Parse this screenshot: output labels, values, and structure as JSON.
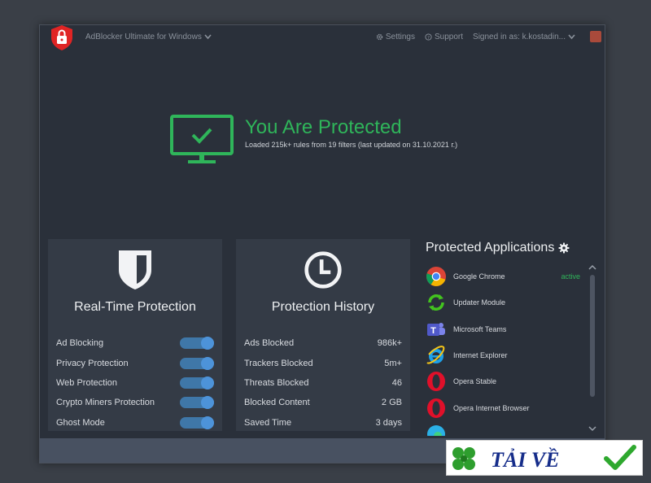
{
  "window": {
    "app_title": "AdBlocker Ultimate for Windows",
    "settings_label": "Settings",
    "support_label": "Support",
    "signed_in_label": "Signed in as: k.kostadin...",
    "close_color": "#a94a3b"
  },
  "status": {
    "title": "You Are Protected",
    "subtitle": "Loaded 215k+ rules from 19 filters (last updated on 31.10.2021 г.)",
    "color": "#2fb55a"
  },
  "realtime": {
    "title": "Real-Time Protection",
    "items": [
      {
        "label": "Ad Blocking",
        "enabled": true
      },
      {
        "label": "Privacy Protection",
        "enabled": true
      },
      {
        "label": "Web Protection",
        "enabled": true
      },
      {
        "label": "Crypto Miners Protection",
        "enabled": true
      },
      {
        "label": "Ghost Mode",
        "enabled": true
      }
    ]
  },
  "history": {
    "title": "Protection History",
    "rows": [
      {
        "label": "Ads Blocked",
        "value": "986k+"
      },
      {
        "label": "Trackers Blocked",
        "value": "5m+"
      },
      {
        "label": "Threats Blocked",
        "value": "46"
      },
      {
        "label": "Blocked Content",
        "value": "2 GB"
      },
      {
        "label": "Saved Time",
        "value": "3 days"
      }
    ]
  },
  "apps": {
    "title": "Protected Applications",
    "items": [
      {
        "name": "Google Chrome",
        "icon": "chrome-icon",
        "status": "active"
      },
      {
        "name": "Updater Module",
        "icon": "updater-icon",
        "status": ""
      },
      {
        "name": "Microsoft Teams",
        "icon": "teams-icon",
        "status": ""
      },
      {
        "name": "Internet Explorer",
        "icon": "ie-icon",
        "status": ""
      },
      {
        "name": "Opera Stable",
        "icon": "opera-icon",
        "status": ""
      },
      {
        "name": "Opera Internet Browser",
        "icon": "opera-icon",
        "status": ""
      },
      {
        "name": "",
        "icon": "edge-icon",
        "status": ""
      }
    ]
  },
  "watermark": {
    "text": "TẢI VỀ"
  }
}
